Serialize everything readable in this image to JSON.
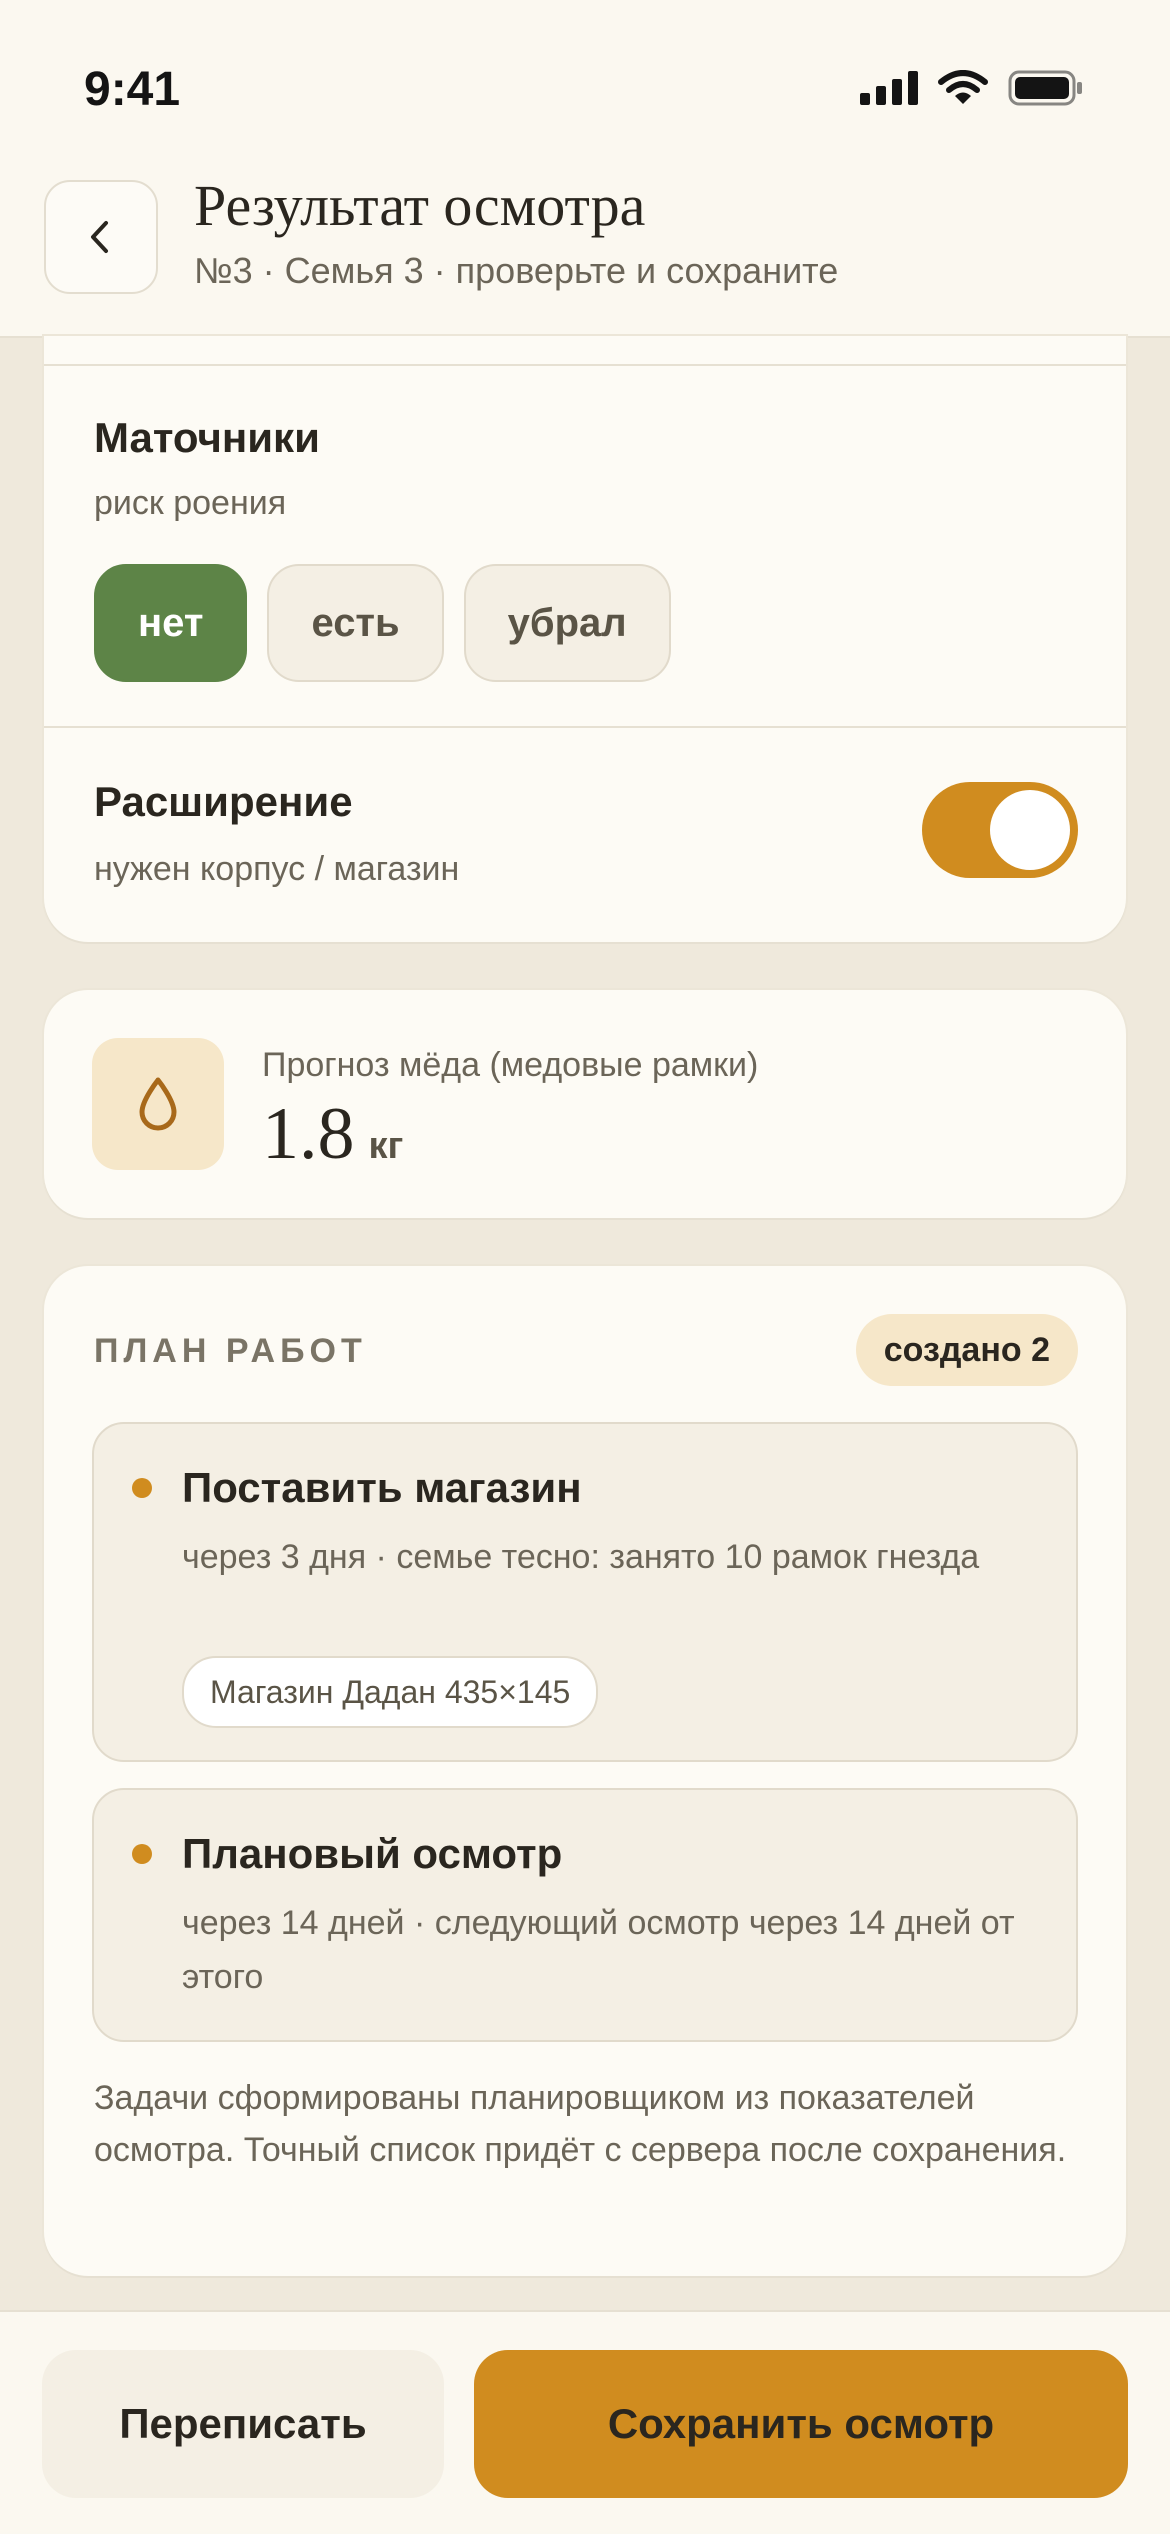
{
  "status": {
    "time": "9:41"
  },
  "header": {
    "title": "Результат осмотра",
    "subtitle": "№3 · Семья 3 · проверьте и сохраните"
  },
  "queen_cells": {
    "title": "Маточники",
    "subtitle": "риск роения",
    "options": [
      "нет",
      "есть",
      "убрал"
    ],
    "selected": "нет"
  },
  "expansion": {
    "title": "Расширение",
    "subtitle": "нужен корпус / магазин",
    "enabled": true
  },
  "honey": {
    "label": "Прогноз мёда (медовые рамки)",
    "value": "1.8",
    "unit": "кг"
  },
  "plan": {
    "title": "ПЛАН РАБОТ",
    "badge": "создано 2",
    "tasks": [
      {
        "title": "Поставить магазин",
        "desc": "через 3 дня · семье тесно: занято 10 рамок гнезда",
        "tag": "Магазин Дадан 435×145"
      },
      {
        "title": "Плановый осмотр",
        "desc": "через 14 дней · следующий осмотр через 14 дней от этого"
      }
    ],
    "note": "Задачи сформированы планировщиком из показателей осмотра. Точный список придёт с сервера после сохранения."
  },
  "footer": {
    "rewrite_label": "Переписать",
    "save_label": "Сохранить осмотр"
  },
  "colors": {
    "accent": "#D08C1F",
    "selected_chip": "#5D8447",
    "background": "#EFE9DC"
  }
}
